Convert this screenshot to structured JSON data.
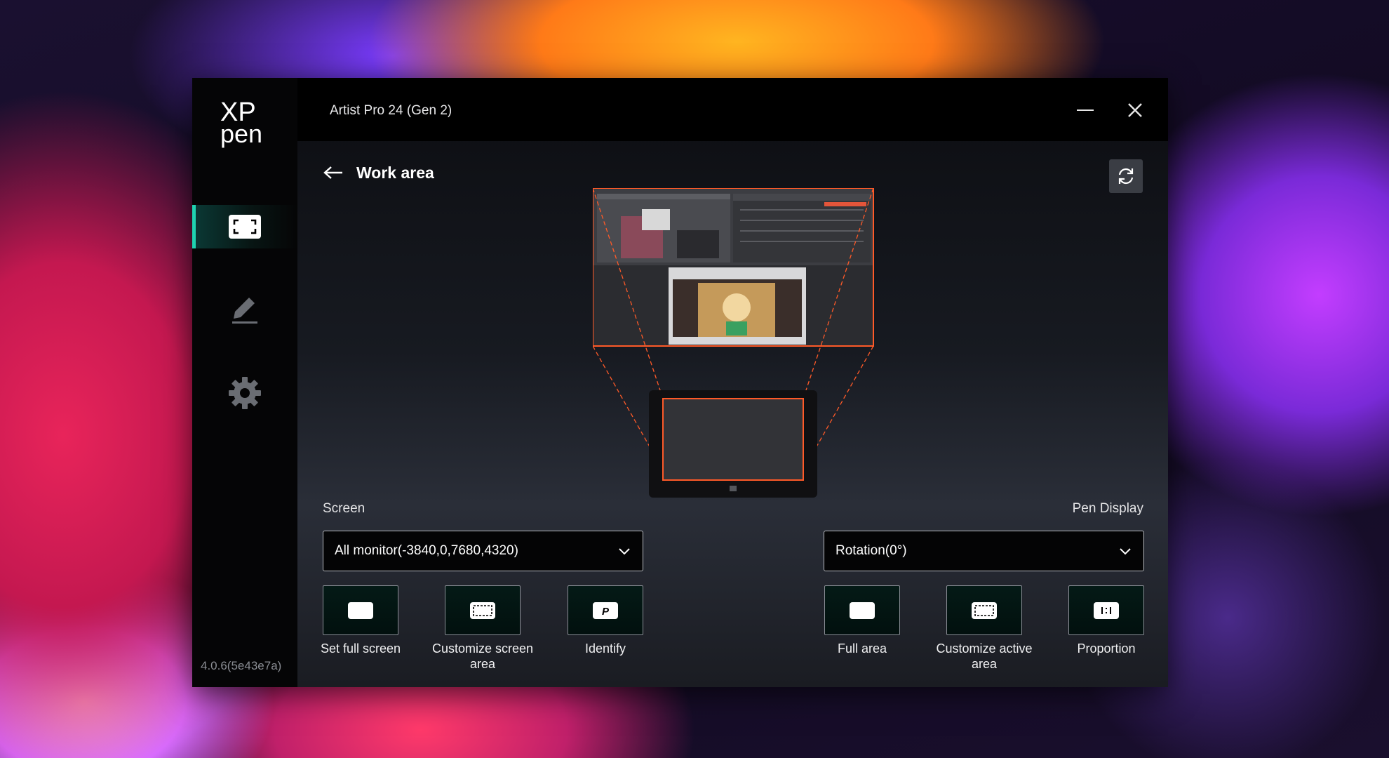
{
  "app": {
    "logo_line1": "XP",
    "logo_line2": "pen",
    "window_title": "Artist Pro 24 (Gen 2)",
    "version": "4.0.6(5e43e7a)",
    "accent_color": "#1fd1b0",
    "highlight_color": "#ff5a28"
  },
  "sidebar": {
    "items": [
      {
        "icon": "work-area-icon",
        "active": true
      },
      {
        "icon": "pen-icon",
        "active": false
      },
      {
        "icon": "gear-icon",
        "active": false
      }
    ]
  },
  "page": {
    "title": "Work area"
  },
  "screen": {
    "label": "Screen",
    "selected": "All monitor(-3840,0,7680,4320)",
    "buttons": [
      {
        "label": "Set full screen",
        "icon": "full-screen-icon"
      },
      {
        "label": "Customize screen area",
        "icon": "custom-screen-area-icon"
      },
      {
        "label": "Identify",
        "icon": "identify-icon"
      }
    ]
  },
  "pen_display": {
    "label": "Pen Display",
    "selected": "Rotation(0°)",
    "buttons": [
      {
        "label": "Full area",
        "icon": "full-area-icon"
      },
      {
        "label": "Customize active area",
        "icon": "custom-active-area-icon"
      },
      {
        "label": "Proportion",
        "icon": "proportion-icon"
      }
    ]
  }
}
